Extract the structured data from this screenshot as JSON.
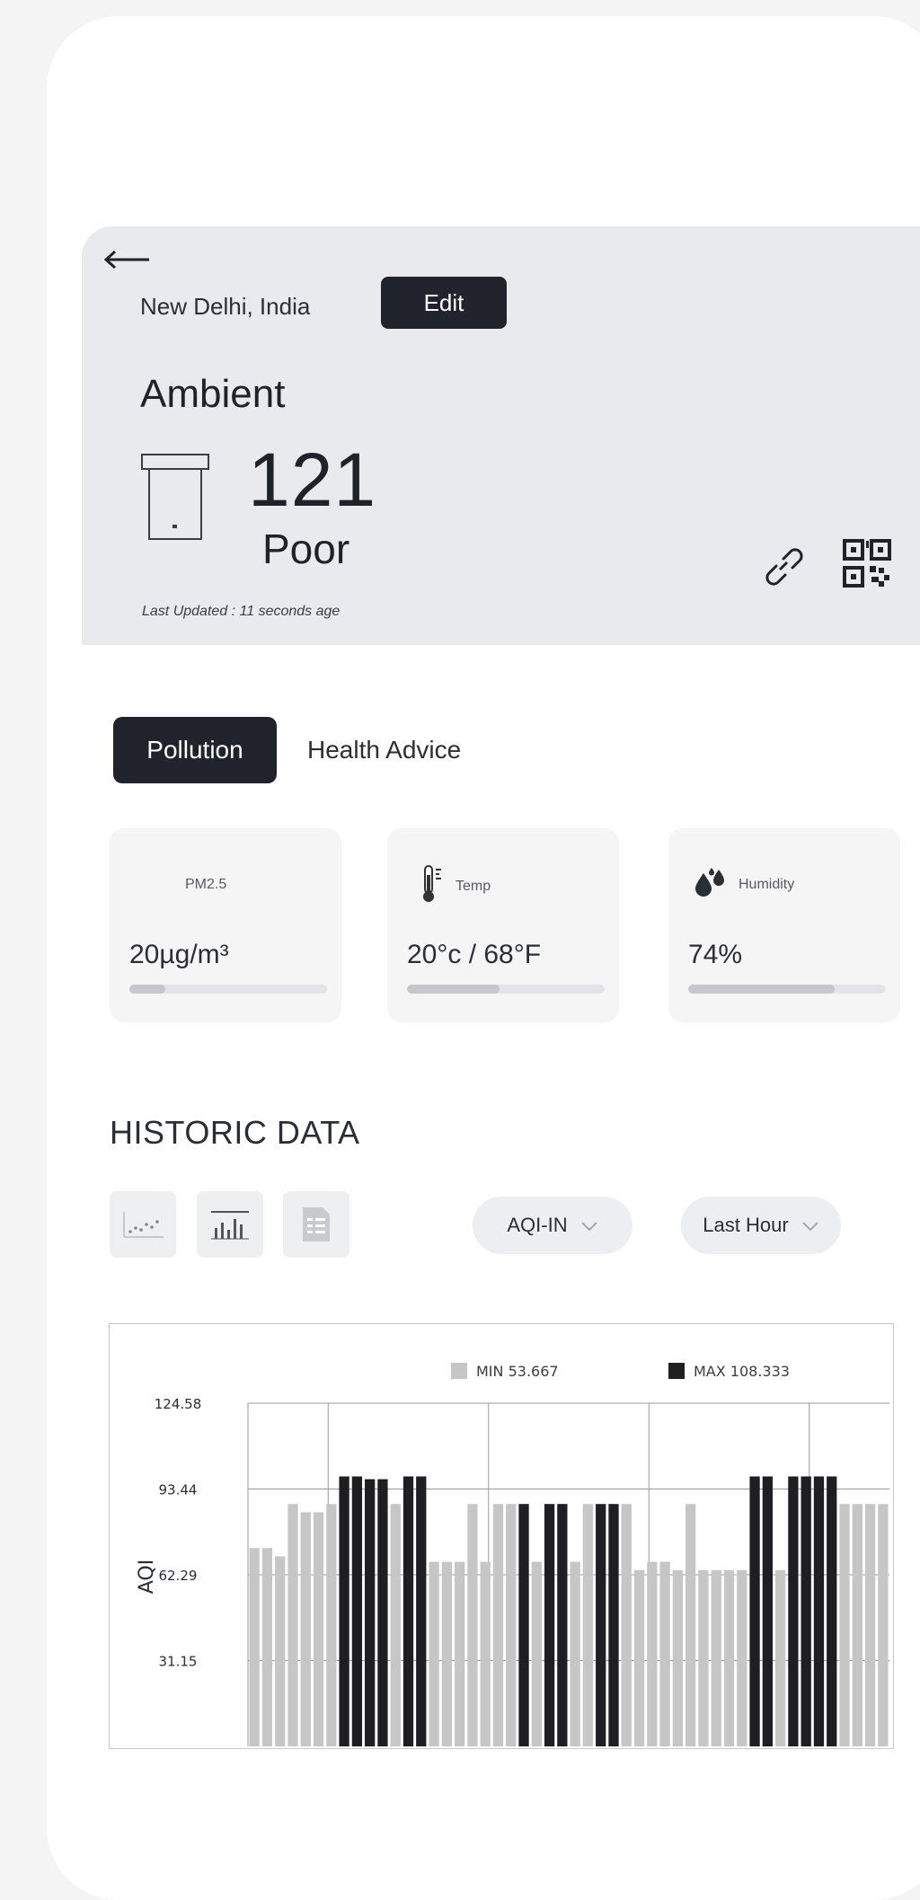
{
  "header": {
    "location": "New Delhi, India",
    "edit_label": "Edit",
    "category": "Ambient",
    "aqi_value": "121",
    "aqi_status": "Poor",
    "last_updated": "Last Updated : 11 seconds age"
  },
  "tabs": [
    {
      "label": "Pollution",
      "active": true
    },
    {
      "label": "Health Advice",
      "active": false
    }
  ],
  "metrics": [
    {
      "label": "PM2.5",
      "value": "20µg/m³",
      "icon": null,
      "progress": 0.18
    },
    {
      "label": "Temp",
      "value": "20°c / 68°F",
      "icon": "thermometer-icon",
      "progress": 0.47
    },
    {
      "label": "Humidity",
      "value": "74%",
      "icon": "water-drops-icon",
      "progress": 0.74
    }
  ],
  "historic": {
    "title": "HISTORIC DATA",
    "views": [
      "scatter-chart-icon",
      "bar-chart-icon",
      "table-icon"
    ],
    "metric_select": "AQI-IN",
    "range_select": "Last Hour"
  },
  "colors": {
    "dark": "#20232b",
    "min_bar": "#c6c6c6",
    "max_bar": "#1f1f22",
    "header_bg": "#e9eaee"
  },
  "chart_data": {
    "type": "bar",
    "ylabel": "AQI",
    "ylim": [
      0,
      124.58
    ],
    "yticks": [
      "124.58",
      "93.44",
      "62.29",
      "31.15"
    ],
    "ytick_values": [
      124.58,
      93.44,
      62.29,
      31.15
    ],
    "grid": true,
    "legend_position": "top",
    "legend": [
      {
        "label": "MIN 53.667",
        "color": "#c6c6c6"
      },
      {
        "label": "MAX 108.333",
        "color": "#1f1f22"
      }
    ],
    "values": [
      72,
      72,
      69,
      88,
      85,
      85,
      88,
      98,
      98,
      97,
      97,
      88,
      98,
      98,
      67,
      67,
      67,
      88,
      67,
      88,
      88,
      88,
      67,
      88,
      88,
      67,
      88,
      88,
      88,
      88,
      64,
      67,
      67,
      64,
      88,
      64,
      64,
      64,
      64,
      98,
      98,
      64,
      98,
      98,
      98,
      98,
      88,
      88,
      88,
      88
    ],
    "highlight": [
      0,
      0,
      0,
      0,
      0,
      0,
      0,
      1,
      1,
      1,
      1,
      0,
      1,
      1,
      0,
      0,
      0,
      0,
      0,
      0,
      0,
      1,
      0,
      1,
      1,
      0,
      0,
      1,
      1,
      0,
      0,
      0,
      0,
      0,
      0,
      0,
      0,
      0,
      0,
      1,
      1,
      0,
      1,
      1,
      1,
      1,
      0,
      0,
      0,
      0
    ]
  }
}
